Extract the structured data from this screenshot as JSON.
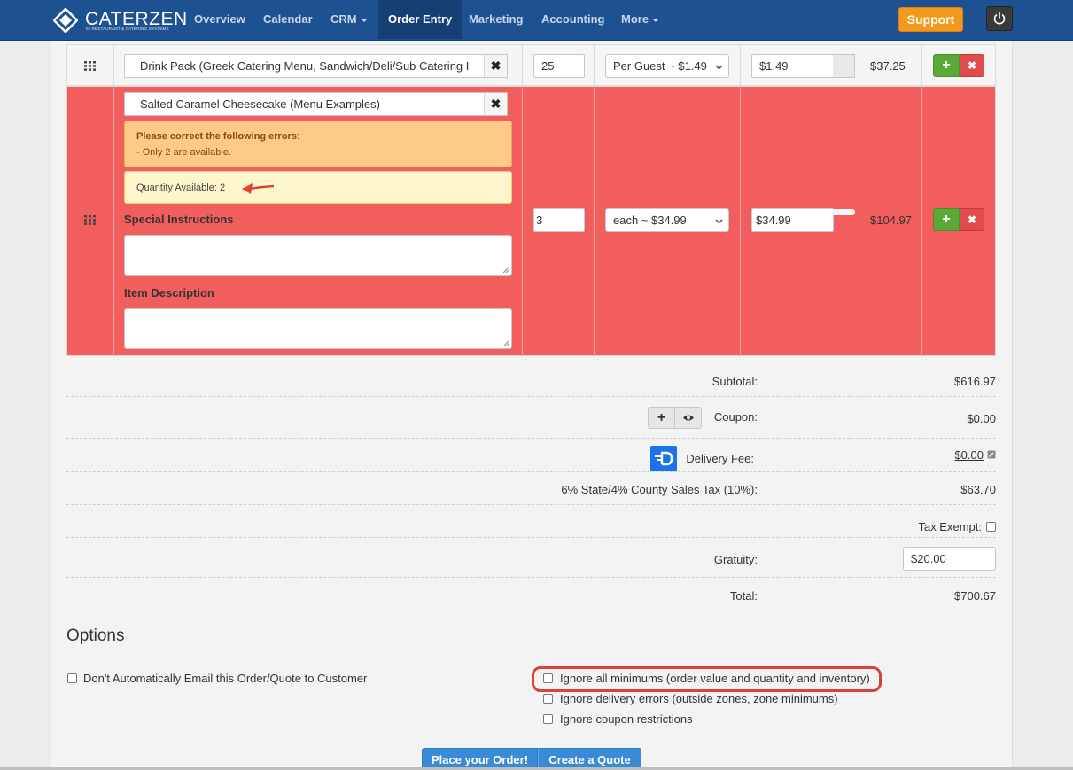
{
  "app": {
    "brand": "CATERZEN",
    "brand_tagline": "by RESTAURANT & CATERING SYSTEMS"
  },
  "nav": {
    "items": [
      {
        "label": "Overview"
      },
      {
        "label": "Calendar"
      },
      {
        "label": "CRM"
      },
      {
        "label": "Order Entry"
      },
      {
        "label": "Marketing"
      },
      {
        "label": "Accounting"
      },
      {
        "label": "More"
      }
    ],
    "support_label": "Support"
  },
  "order_items": [
    {
      "item_name": "Drink Pack (Greek Catering Menu, Sandwich/Deli/Sub Catering I",
      "quantity": "25",
      "pricing_option": "Per Guest ~ $1.49",
      "unit_price": "$1.49",
      "line_total": "$37.25"
    },
    {
      "item_name": "Salted Caramel Cheesecake (Menu Examples)",
      "error_title": "Please correct the following errors",
      "error_colon": ":",
      "error_message": "- Only 2 are available.",
      "quantity_available": "Quantity Available: 2",
      "special_instructions_label": "Special Instructions",
      "special_instructions_value": "",
      "item_description_label": "Item Description",
      "item_description_value": "",
      "quantity": "3",
      "pricing_option": "each ~ $34.99",
      "unit_price": "$34.99",
      "line_total": "$104.97"
    }
  ],
  "totals": {
    "subtotal_label": "Subtotal:",
    "subtotal_value": "$616.97",
    "coupon_label": "Coupon:",
    "coupon_value": "$0.00",
    "delivery_label": "Delivery Fee:",
    "delivery_value": "$0.00",
    "tax_label": "6% State/4% County Sales Tax (10%):",
    "tax_value": "$63.70",
    "tax_exempt_label": "Tax Exempt:",
    "gratuity_label": "Gratuity:",
    "gratuity_value": "$20.00",
    "total_label": "Total:",
    "total_value": "$700.67"
  },
  "options": {
    "title": "Options",
    "dont_email": "Don't Automatically Email this Order/Quote to Customer",
    "ignore_minimums": "Ignore all minimums (order value and quantity and inventory)",
    "ignore_delivery": "Ignore delivery errors (outside zones, zone minimums)",
    "ignore_coupon": "Ignore coupon restrictions"
  },
  "actions": {
    "place_order": "Place your Order!",
    "create_quote": "Create a Quote"
  },
  "colors": {
    "nav_bg": "#1d5192",
    "error_row": "#f25d5d",
    "support": "#f39a1e",
    "primary_button": "#3a8bd6",
    "add_button": "#5ca839",
    "remove_button": "#e04b4b",
    "highlight_ring": "#d9423b"
  }
}
